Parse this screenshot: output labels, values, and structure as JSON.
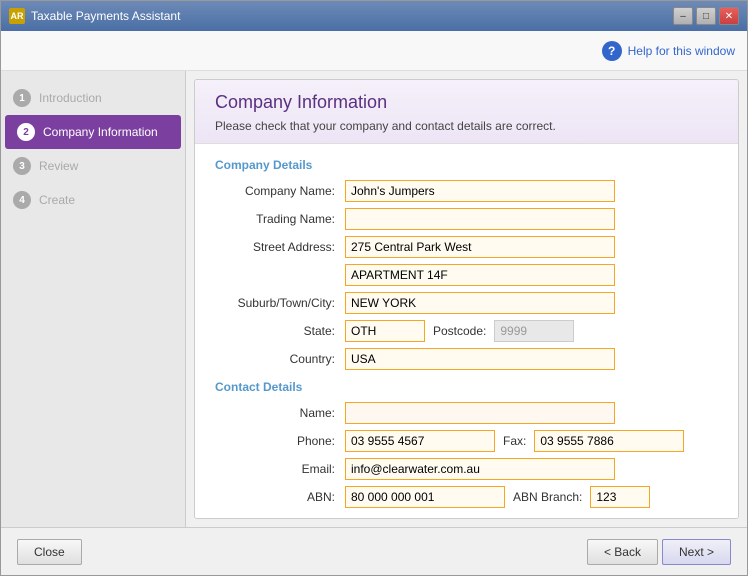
{
  "window": {
    "title": "Taxable Payments Assistant",
    "icon_label": "AR",
    "minimize_label": "–",
    "maximize_label": "□",
    "close_label": "✕"
  },
  "help": {
    "label": "Help for this window"
  },
  "sidebar": {
    "items": [
      {
        "step": "1",
        "label": "Introduction",
        "state": "inactive"
      },
      {
        "step": "2",
        "label": "Company Information",
        "state": "active"
      },
      {
        "step": "3",
        "label": "Review",
        "state": "inactive"
      },
      {
        "step": "4",
        "label": "Create",
        "state": "inactive"
      }
    ]
  },
  "content": {
    "title": "Company Information",
    "subtitle": "Please check that your company and contact details are correct.",
    "company_section_label": "Company Details",
    "contact_section_label": "Contact Details",
    "fields": {
      "company_name_label": "Company Name:",
      "company_name_value": "John's Jumpers",
      "trading_name_label": "Trading Name:",
      "trading_name_value": "",
      "street_address_label": "Street Address:",
      "street_address_value": "275 Central Park West",
      "street_address2_value": "APARTMENT 14F",
      "suburb_label": "Suburb/Town/City:",
      "suburb_value": "NEW YORK",
      "state_label": "State:",
      "state_value": "OTH",
      "postcode_label": "Postcode:",
      "postcode_value": "9999",
      "country_label": "Country:",
      "country_value": "USA",
      "name_label": "Name:",
      "name_value": "",
      "phone_label": "Phone:",
      "phone_value": "03 9555 4567",
      "fax_label": "Fax:",
      "fax_value": "03 9555 7886",
      "email_label": "Email:",
      "email_value": "info@clearwater.com.au",
      "abn_label": "ABN:",
      "abn_value": "80 000 000 001",
      "abn_branch_label": "ABN Branch:",
      "abn_branch_value": "123"
    }
  },
  "footer": {
    "close_label": "Close",
    "back_label": "< Back",
    "next_label": "Next >"
  }
}
